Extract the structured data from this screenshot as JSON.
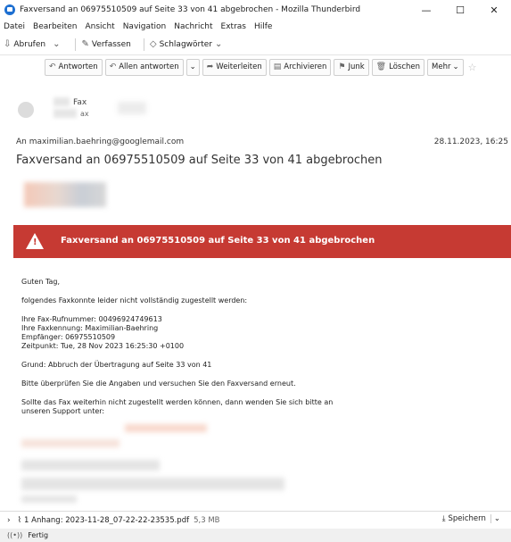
{
  "window": {
    "title": "Faxversand an 06975510509 auf Seite 33 von 41 abgebrochen - Mozilla Thunderbird",
    "minimize": "—",
    "maximize": "☐",
    "close": "✕"
  },
  "menu": [
    "Datei",
    "Bearbeiten",
    "Ansicht",
    "Navigation",
    "Nachricht",
    "Extras",
    "Hilfe"
  ],
  "toolbar": {
    "get_mail": "Abrufen",
    "compose": "Verfassen",
    "tags": "Schlagwörter"
  },
  "message_toolbar": {
    "reply": "Antworten",
    "reply_all": "Allen antworten",
    "forward": "Weiterleiten",
    "archive": "Archivieren",
    "junk": "Junk",
    "delete": "Löschen",
    "more": "Mehr"
  },
  "header": {
    "from_name": "Fax",
    "from_short": "ax",
    "to": "An  maximilian.baehring@googlemail.com",
    "date": "28.11.2023, 16:25",
    "subject": "Faxversand an 06975510509 auf Seite 33 von 41 abgebrochen"
  },
  "banner": {
    "text": "Faxversand an 06975510509 auf Seite 33 von 41 abgebrochen",
    "color": "#c63a33"
  },
  "body": {
    "greeting": "Guten Tag,",
    "intro": "folgendes Faxkonnte leider nicht vollständig zugestellt werden:",
    "fax_number": "Ihre Fax-Rufnummer: 00496924749613",
    "fax_id": "Ihre Faxkennung: Maximilian-Baehring",
    "recipient": "Empfänger: 06975510509",
    "time": "Zeitpunkt: Tue, 28 Nov 2023 16:25:30 +0100",
    "reason": "Grund: Abbruch der Übertragung auf Seite 33 von 41",
    "advice": "Bitte überprüfen Sie die Angaben und versuchen Sie den Faxversand erneut.",
    "support1": "Sollte das Fax weiterhin nicht zugestellt werden können, dann wenden Sie sich bitte an",
    "support2": "unseren Support unter:"
  },
  "attachment": {
    "label": "1 Anhang: 2023-11-28_07-22-22-23535.pdf",
    "size": "5,3 MB",
    "save": "Speichern"
  },
  "status": {
    "text": "Fertig"
  }
}
